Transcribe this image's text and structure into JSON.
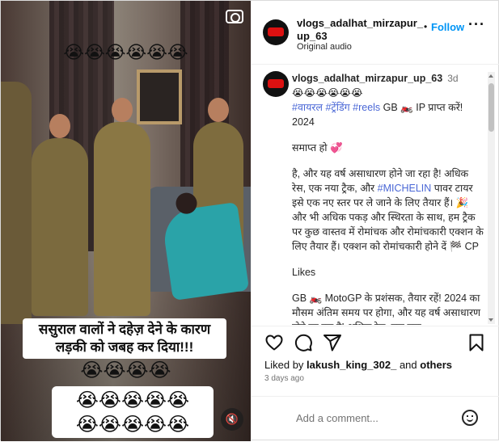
{
  "media": {
    "emoji_top": "😭😭😭😭😭😭",
    "caption": "ससुराल वालों ने दहेज़ देने के कारण लड़की को जबह कर दिया!!!",
    "emoji_mid": "😭😭😭😭",
    "emoji_block_row1": "😭😭😭😭😭",
    "emoji_block_row2": "😭😭😭😭😭"
  },
  "header": {
    "username": "vlogs_adalhat_mirzapur_up_63",
    "audio": "Original audio",
    "dot": "•",
    "follow": "Follow",
    "more": "···"
  },
  "comment": {
    "username": "vlogs_adalhat_mirzapur_up_63",
    "age": "3d",
    "line1": "😭😭😭😭😭😭",
    "hashtags": "#वायरल #ट्रेंडिंग #reels",
    "line2_rest": "GB 🏍️ IP प्राप्त करें! 2024",
    "p2": "समाप्त हो 💞",
    "p3_a": "है, और यह वर्ष असाधारण होने जा रहा है! अधिक रेस, एक नया ट्रैक, और ",
    "p3_tag": "#MICHELIN",
    "p3_b": " पावर टायर इसे एक नए स्तर पर ले जाने के लिए तैयार हैं। 🎉 और भी अधिक पकड़ और स्थिरता के साथ, हम ट्रैक पर कुछ वास्तव में रोमांचक और रोमांचकारी एक्शन के लिए तैयार हैं। एक्शन को रोमांचकारी होने दें 🏁 CP",
    "p4": "Likes",
    "p5": "GB 🏍️ MotoGP के प्रशंसक, तैयार रहें! 2024 का मौसम अंतिम समय पर होगा, और यह वर्ष असाधारण होने जा रहा है! अधिक रेस, एक नया"
  },
  "likes": {
    "prefix": "Liked by ",
    "user": "lakush_king_302_",
    "mid": " and ",
    "others": "others"
  },
  "time": "3 days ago",
  "add_comment": {
    "placeholder": "Add a comment..."
  },
  "icons": [
    "camera-icon",
    "mute-icon",
    "heart-icon",
    "comment-icon",
    "share-icon",
    "bookmark-icon",
    "emoji-icon",
    "more-icon"
  ]
}
